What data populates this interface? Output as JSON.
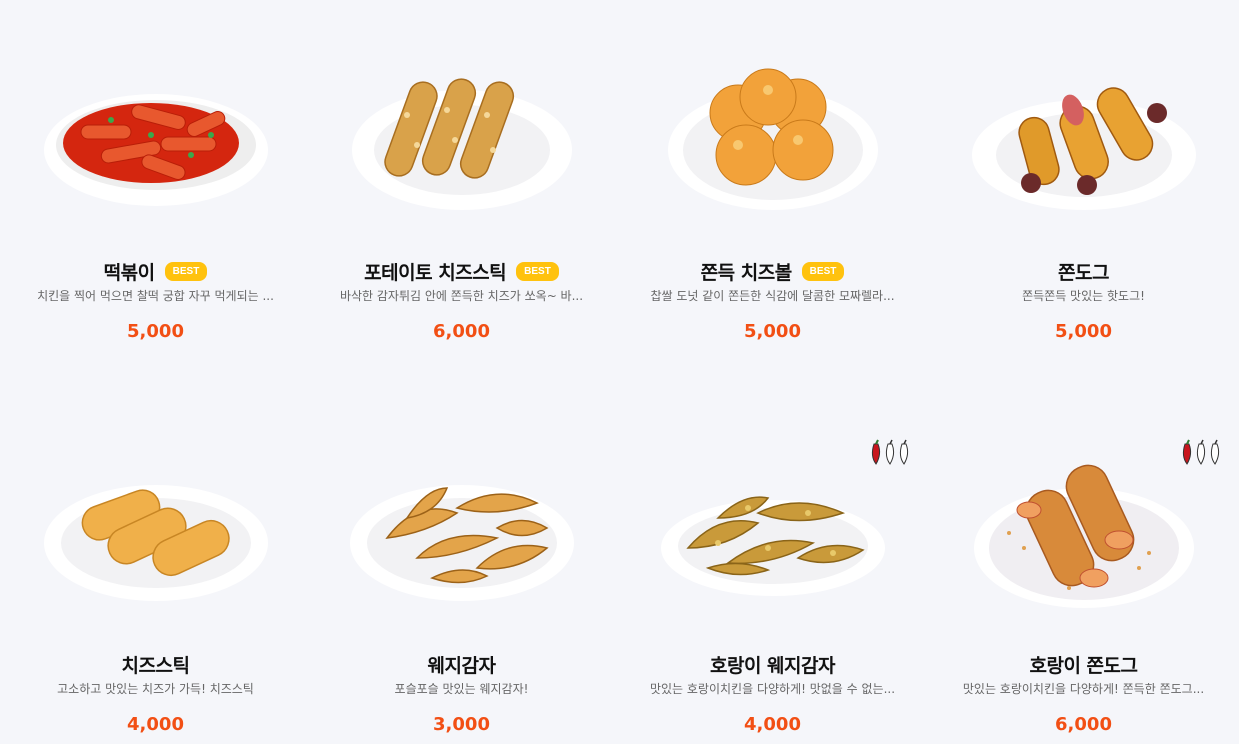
{
  "menu": {
    "items": [
      {
        "name": "떡볶이",
        "badge": "BEST",
        "desc": "치킨을 찍어 먹으면 찰떡 궁합 자꾸 먹게되는 ...",
        "price": "5,000",
        "image_icon": "tteokbokki-icon",
        "spicy": false
      },
      {
        "name": "포테이토 치즈스틱",
        "badge": "BEST",
        "desc": "바삭한 감자튀김 안에 쫀득한 치즈가 쏘옥~ 바...",
        "price": "6,000",
        "image_icon": "potato-cheese-stick-icon",
        "spicy": false
      },
      {
        "name": "쫀득 치즈볼",
        "badge": "BEST",
        "desc": "찹쌀 도넛 같이 쫀든한 식감에 달콤한 모짜렐라...",
        "price": "5,000",
        "image_icon": "cheese-ball-icon",
        "spicy": false
      },
      {
        "name": "쫀도그",
        "badge": "",
        "desc": "쫀득쫀득 맛있는 핫도그!",
        "price": "5,000",
        "image_icon": "corn-dog-icon",
        "spicy": false
      },
      {
        "name": "치즈스틱",
        "badge": "",
        "desc": "고소하고 맛있는 치즈가 가득! 치즈스틱",
        "price": "4,000",
        "image_icon": "cheese-stick-icon",
        "spicy": false
      },
      {
        "name": "웨지감자",
        "badge": "",
        "desc": "포슬포슬 맛있는 웨지감자!",
        "price": "3,000",
        "image_icon": "wedge-potato-icon",
        "spicy": false
      },
      {
        "name": "호랑이 웨지감자",
        "badge": "",
        "desc": "맛있는 호랑이치킨을 다양하게! 맛없을 수 없는...",
        "price": "4,000",
        "image_icon": "tiger-wedge-potato-icon",
        "spicy": true
      },
      {
        "name": "호랑이 쫀도그",
        "badge": "",
        "desc": "맛있는 호랑이치킨을 다양하게! 쫀득한 쫀도그...",
        "price": "6,000",
        "image_icon": "tiger-corn-dog-icon",
        "spicy": true
      }
    ]
  },
  "colors": {
    "background": "#f5f6fa",
    "price": "#f24f14",
    "badge": "#ffc20e",
    "name": "#111111",
    "desc": "#666666"
  }
}
